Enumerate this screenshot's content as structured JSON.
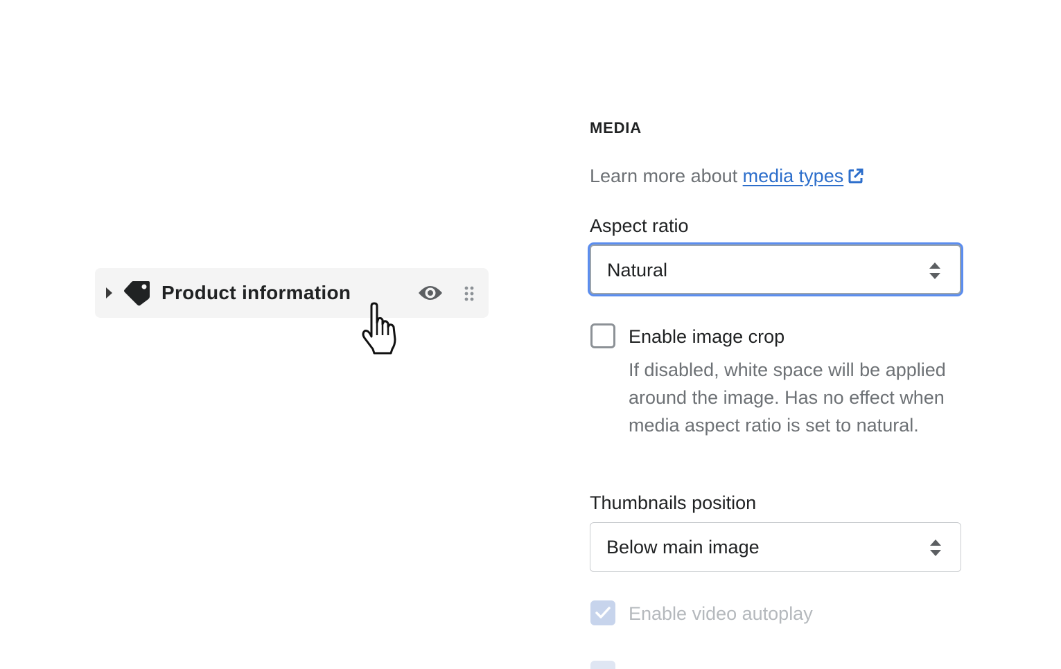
{
  "left_panel": {
    "section_item": {
      "label": "Product information"
    }
  },
  "settings": {
    "header": "MEDIA",
    "learn_more": {
      "prefix": "Learn more about ",
      "link_text": "media types"
    },
    "aspect_ratio": {
      "label": "Aspect ratio",
      "value": "Natural"
    },
    "image_crop": {
      "label": "Enable image crop",
      "checked": false,
      "help": "If disabled, white space will be applied around the image. Has no effect when media aspect ratio is set to natural."
    },
    "thumbnails_position": {
      "label": "Thumbnails position",
      "value": "Below main image"
    },
    "video_autoplay": {
      "label": "Enable video autoplay",
      "checked": true,
      "disabled": true
    }
  },
  "colors": {
    "link": "#2c6ecb",
    "focus_ring": "#5b8def",
    "text": "#202223",
    "muted": "#6d7175"
  }
}
